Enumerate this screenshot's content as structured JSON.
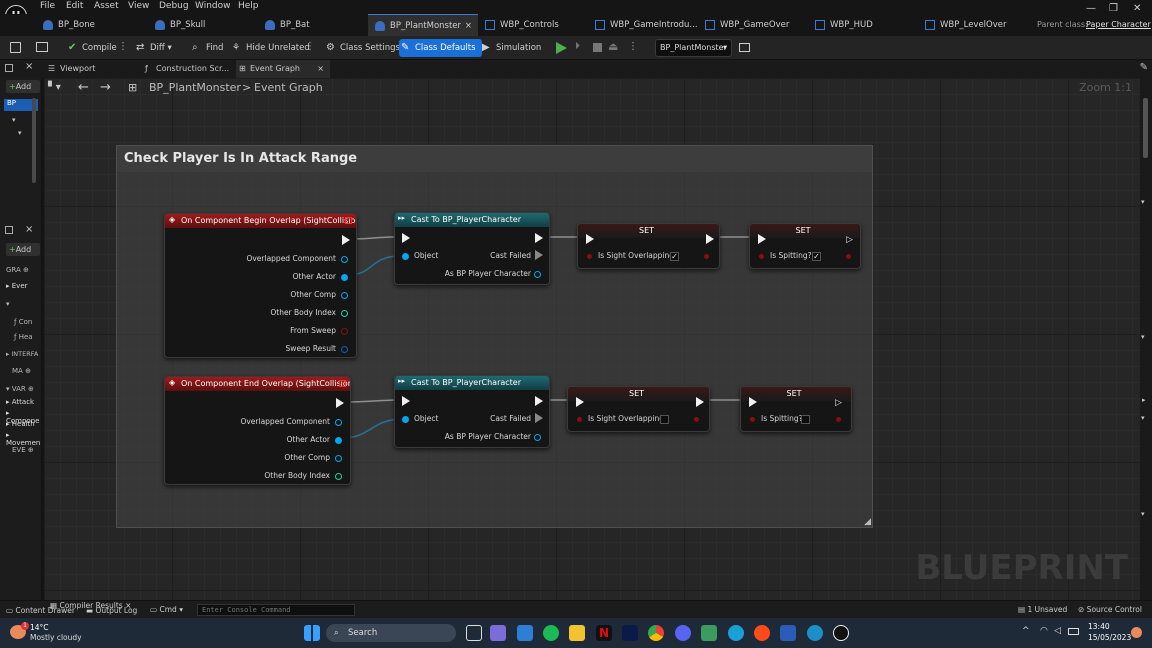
{
  "menu": [
    "File",
    "Edit",
    "Asset",
    "View",
    "Debug",
    "Window",
    "Help"
  ],
  "tabs": [
    {
      "label": "BP_Bone",
      "color": "#4a90e2"
    },
    {
      "label": "BP_Skull",
      "color": "#4a90e2"
    },
    {
      "label": "BP_Bat",
      "color": "#4a90e2"
    },
    {
      "label": "BP_PlantMonster",
      "color": "#4a90e2",
      "close": "×"
    },
    {
      "label": "WBP_Controls",
      "color": "#4a90e2"
    },
    {
      "label": "WBP_GameIntrodu...",
      "color": "#4a90e2"
    },
    {
      "label": "WBP_GameOver",
      "color": "#4a90e2"
    },
    {
      "label": "WBP_HUD",
      "color": "#4a90e2"
    },
    {
      "label": "WBP_LevelOver",
      "color": "#4a90e2"
    }
  ],
  "parent_class": {
    "label": "Parent class:",
    "value": "Paper Character"
  },
  "toolbar": {
    "compile": "Compile",
    "diff": "Diff",
    "find": "Find",
    "hide_unrelated": "Hide Unrelated",
    "class_settings": "Class Settings",
    "class_defaults": "Class Defaults",
    "simulation": "Simulation",
    "debug_object": "BP_PlantMonster"
  },
  "left_panel": {
    "add": "Add",
    "add2": "Add",
    "graphs": "GRA",
    "event": "Ever",
    "construction": "Con",
    "health": "Hea",
    "interfaces": "INTERFA",
    "macros": "MA",
    "variables": "VAR",
    "var_items": [
      "Attack",
      "Compone",
      "Health",
      "Movemen"
    ],
    "dispatchers": "EVE"
  },
  "sub_tabs": {
    "viewport": "Viewport",
    "construction": "Construction Scr...",
    "event_graph": "Event Graph"
  },
  "breadcrumb": {
    "root": "BP_PlantMonster",
    "separator": ">",
    "current": "Event Graph"
  },
  "zoom": "Zoom 1:1",
  "comment_title": "Check Player Is In Attack Range",
  "nodes": {
    "begin_overlap": {
      "title": "On Component Begin Overlap (SightCollision)",
      "pins": [
        "Overlapped Component",
        "Other Actor",
        "Other Comp",
        "Other Body Index",
        "From Sweep",
        "Sweep Result"
      ]
    },
    "end_overlap": {
      "title": "On Component End Overlap (SightCollision)",
      "pins": [
        "Overlapped Component",
        "Other Actor",
        "Other Comp",
        "Other Body Index"
      ]
    },
    "cast1": {
      "title": "Cast To BP_PlayerCharacter",
      "object": "Object",
      "failed": "Cast Failed",
      "as": "As BP Player Character"
    },
    "cast2": {
      "title": "Cast To BP_PlayerCharacter",
      "object": "Object",
      "failed": "Cast Failed",
      "as": "As BP Player Character"
    },
    "set1": {
      "title": "SET",
      "var": "Is Sight Overlapping?",
      "checked": true
    },
    "set2": {
      "title": "SET",
      "var": "Is Spitting?",
      "checked": true
    },
    "set3": {
      "title": "SET",
      "var": "Is Sight Overlapping?",
      "checked": false
    },
    "set4": {
      "title": "SET",
      "var": "Is Spitting?",
      "checked": false
    }
  },
  "watermark": "BLUEPRINT",
  "status": {
    "content_drawer": "Content Drawer",
    "output_log": "Output Log",
    "compiler_results": "Compiler Results",
    "cmd": "Cmd",
    "console_placeholder": "Enter Console Command",
    "unsaved": "1 Unsaved",
    "source_control": "Source Control"
  },
  "taskbar": {
    "temp": "14°C",
    "weather": "Mostly cloudy",
    "search": "Search",
    "time": "13:40",
    "date": "15/05/2023",
    "weather_badge": "1"
  }
}
